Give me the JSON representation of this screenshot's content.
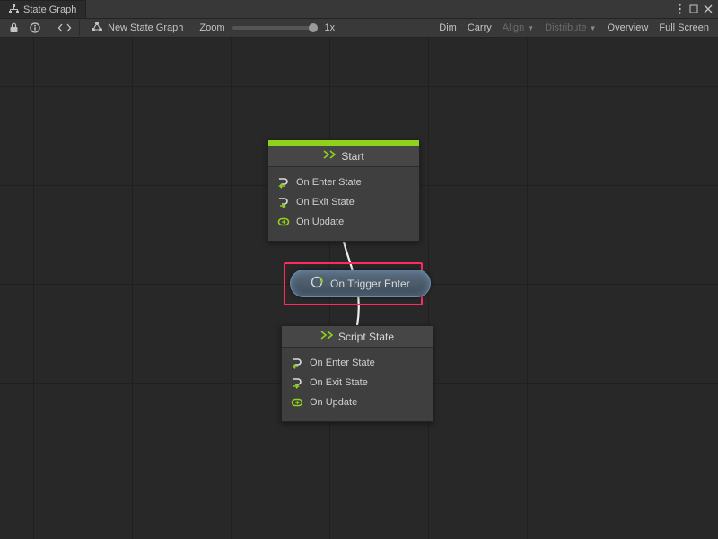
{
  "tab": {
    "title": "State Graph"
  },
  "toolbar": {
    "new_graph": "New State Graph",
    "zoom_label": "Zoom",
    "zoom_value": "1x",
    "dim": "Dim",
    "carry": "Carry",
    "align": "Align",
    "distribute": "Distribute",
    "overview": "Overview",
    "fullscreen": "Full Screen"
  },
  "nodes": {
    "start": {
      "title": "Start",
      "rows": [
        "On Enter State",
        "On Exit State",
        "On Update"
      ]
    },
    "script": {
      "title": "Script State",
      "rows": [
        "On Enter State",
        "On Exit State",
        "On Update"
      ]
    }
  },
  "transition": {
    "label": "On Trigger Enter"
  }
}
